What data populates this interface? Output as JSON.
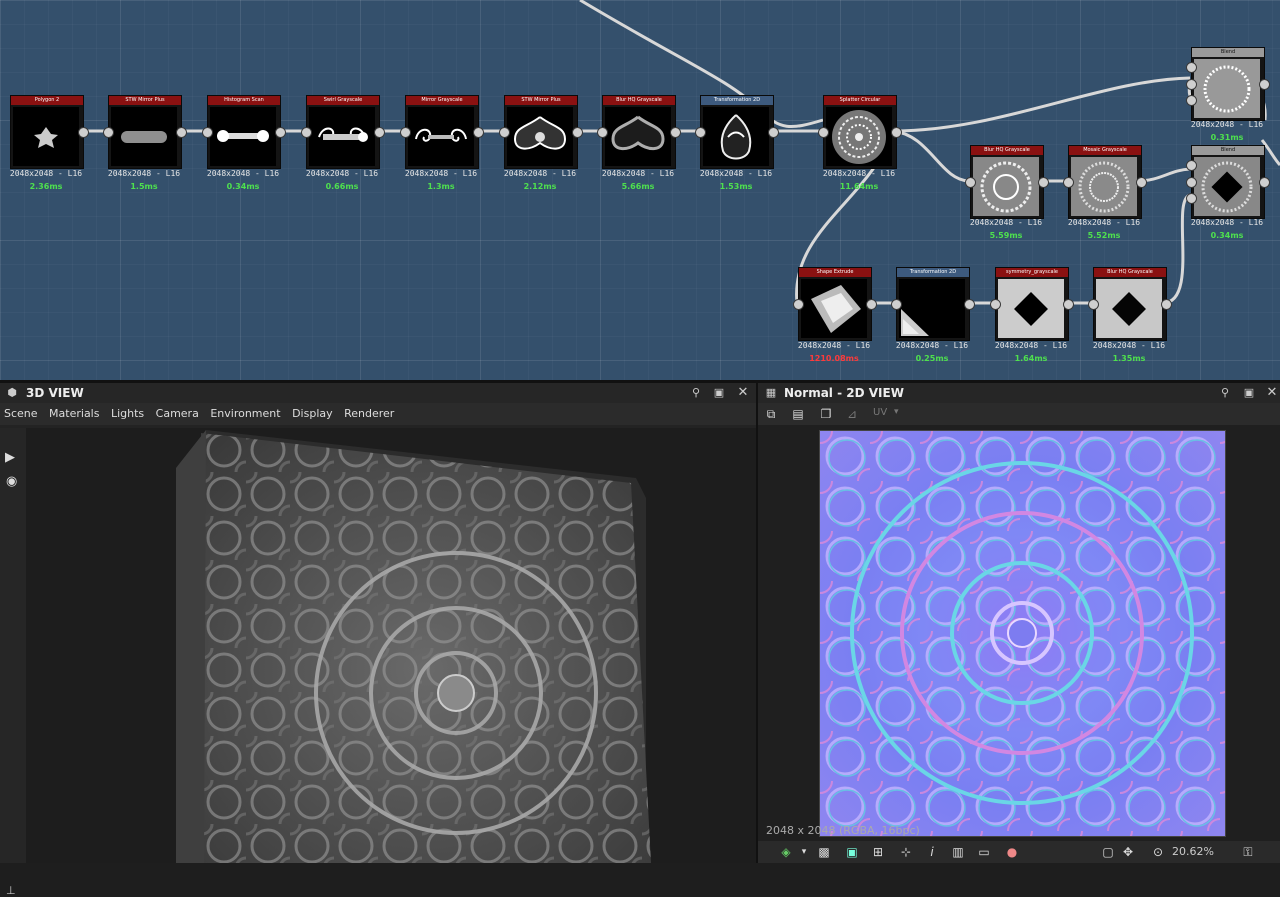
{
  "graph": {
    "nodes": [
      {
        "title": "Polygon 2",
        "resolution": "2048x2048 - L16",
        "time": "2.36ms",
        "header": "red"
      },
      {
        "title": "STW Mirror Plus",
        "resolution": "2048x2048 - L16",
        "time": "1.5ms",
        "header": "red"
      },
      {
        "title": "Histogram Scan",
        "resolution": "2048x2048 - L16",
        "time": "0.34ms",
        "header": "red"
      },
      {
        "title": "Swirl Grayscale",
        "resolution": "2048x2048 - L16",
        "time": "0.66ms",
        "header": "red"
      },
      {
        "title": "Mirror Grayscale",
        "resolution": "2048x2048 - L16",
        "time": "1.3ms",
        "header": "red"
      },
      {
        "title": "STW Mirror Plus",
        "resolution": "2048x2048 - L16",
        "time": "2.12ms",
        "header": "red"
      },
      {
        "title": "Blur HQ Grayscale",
        "resolution": "2048x2048 - L16",
        "time": "5.66ms",
        "header": "red"
      },
      {
        "title": "Transformation 2D",
        "resolution": "2048x2048 - L16",
        "time": "1.53ms",
        "header": "blue"
      },
      {
        "title": "Splatter Circular",
        "resolution": "2048x2048 - L16",
        "time": "11.64ms",
        "header": "red"
      },
      {
        "title": "Blur HQ Grayscale",
        "resolution": "2048x2048 - L16",
        "time": "5.59ms",
        "header": "red"
      },
      {
        "title": "Mosaic Grayscale",
        "resolution": "2048x2048 - L16",
        "time": "5.52ms",
        "header": "red"
      },
      {
        "title": "Blend",
        "resolution": "2048x2048 - L16",
        "time": "0.31ms",
        "header": "gray"
      },
      {
        "title": "Blend",
        "resolution": "2048x2048 - L16",
        "time": "0.34ms",
        "header": "gray"
      },
      {
        "title": "Shape Extrude",
        "resolution": "2048x2048 - L16",
        "time": "1210.08ms",
        "header": "red"
      },
      {
        "title": "Transformation 2D",
        "resolution": "2048x2048 - L16",
        "time": "0.25ms",
        "header": "blue"
      },
      {
        "title": "symmetry_grayscale",
        "resolution": "2048x2048 - L16",
        "time": "1.64ms",
        "header": "red"
      },
      {
        "title": "Blur HQ Grayscale",
        "resolution": "2048x2048 - L16",
        "time": "1.35ms",
        "header": "red"
      }
    ]
  },
  "view3d": {
    "title": "3D VIEW",
    "menu": [
      "Scene",
      "Materials",
      "Lights",
      "Camera",
      "Environment",
      "Display",
      "Renderer"
    ],
    "icons": [
      "cube-icon",
      "pin-icon",
      "maximize-icon",
      "close-icon",
      "camera-icon",
      "light-icon"
    ]
  },
  "view2d": {
    "title": "Normal - 2D VIEW",
    "uv_label": "UV",
    "info": "2048 x 2048 (RGBA, 16bpc)",
    "zoom": "20.62%"
  },
  "colors": {
    "graph_bg": "#34506c",
    "node_red": "#8a1111",
    "node_blue": "#3d5a7e",
    "time_ok": "#4ee04e",
    "time_warn": "#ff3a3a"
  }
}
